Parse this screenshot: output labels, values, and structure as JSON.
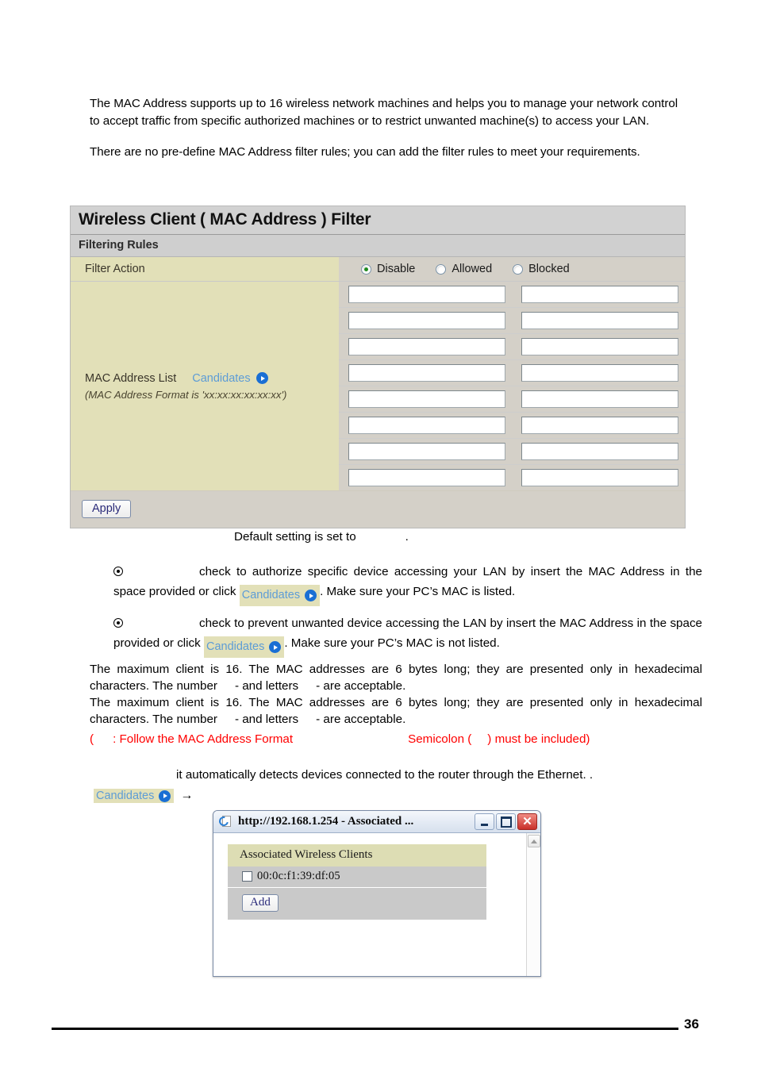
{
  "document": {
    "intro_paragraphs": [
      "The MAC Address supports up to 16 wireless network machines and helps you to manage your network control to accept traffic from specific authorized machines or to restrict unwanted machine(s) to access your LAN.",
      "There are no pre-define MAC Address filter rules; you can add the filter rules to meet your requirements."
    ],
    "page_number": "36"
  },
  "panel": {
    "title": "Wireless Client ( MAC Address ) Filter",
    "subtitle": "Filtering Rules",
    "filter_action": {
      "label": "Filter Action",
      "options": [
        {
          "label": "Disable",
          "selected": true
        },
        {
          "label": "Allowed",
          "selected": false
        },
        {
          "label": "Blocked",
          "selected": false
        }
      ]
    },
    "mac_address_list": {
      "label": "MAC Address List",
      "candidates_label": "Candidates",
      "format_hint": "(MAC Address Format is 'xx:xx:xx:xx:xx:xx')",
      "entries": [
        "",
        "",
        "",
        "",
        "",
        "",
        "",
        "",
        "",
        "",
        "",
        "",
        "",
        "",
        "",
        ""
      ],
      "input_placeholder": ""
    },
    "apply_label": "Apply"
  },
  "notes": {
    "default_setting_prefix": "Default setting is set to",
    "default_setting_suffix": ".",
    "allowed_note_part1": "check to authorize specific device accessing your LAN by insert the MAC Address in the space provided or click",
    "allowed_note_candidates": "Candidates",
    "allowed_note_part2": ". Make sure your PC’s MAC is listed.",
    "blocked_note_part1": "check to prevent unwanted device accessing the LAN by insert the MAC Address in the space provided or click",
    "blocked_note_candidates": "Candidates",
    "blocked_note_part2": ". Make sure your PC’s MAC is not listed.",
    "max_client_line_a": "The maximum client is 16.  The MAC addresses are 6 bytes long; they are presented only in hexadecimal characters. The number",
    "max_client_line_b": "-   and letters",
    "max_client_line_c": "-   are acceptable.",
    "red_open_paren": "(",
    "red_colon": ":  Follow the MAC Address Format",
    "red_semicolon": "Semicolon (",
    "red_tail": ") must be included)",
    "ethernet_note": "it automatically detects devices connected to the router through the Ethernet. .",
    "candidates_label": "Candidates",
    "arrow": "→"
  },
  "dialog": {
    "title": "http://192.168.1.254 - Associated ...",
    "minimize_label": "Minimize",
    "maximize_label": "Maximize",
    "close_label": "✕",
    "table_header": "Associated Wireless Clients",
    "clients": [
      {
        "mac": "00:0c:f1:39:df:05",
        "checked": false
      }
    ],
    "add_label": "Add"
  },
  "colors": {
    "panel_label_bg": "#e2e0b8",
    "panel_bg": "#d4d0c8",
    "link_blue": "#5d9cd6",
    "red_note": "#ff0000",
    "selected_radio": "#1f8a1f"
  }
}
